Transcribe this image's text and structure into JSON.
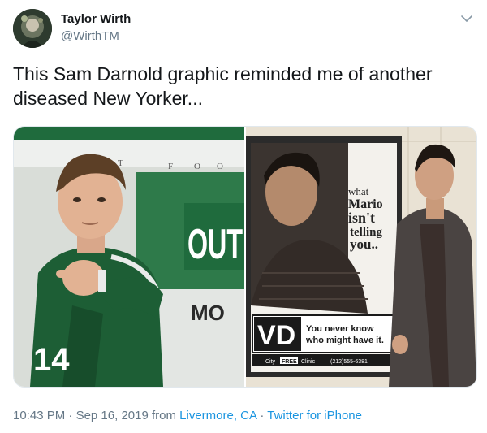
{
  "user": {
    "name": "Taylor Wirth",
    "handle": "@WirthTM"
  },
  "tweet": {
    "text_line1": "This Sam Darnold graphic reminded me of another",
    "text_line2": "diseased New Yorker..."
  },
  "media": {
    "left": {
      "banner_letters": [
        "T",
        "F",
        "O",
        "O"
      ],
      "sign_out": "OUT",
      "sign_mo": "MO"
    },
    "right": {
      "poster_words": [
        "what",
        "Mario",
        "isn't",
        "telling",
        "you.."
      ],
      "vd": "VD",
      "vd_tag_line1": "You never know",
      "vd_tag_line2": "who might have it.",
      "footer_city": "City",
      "footer_free": "FREE",
      "footer_clinic": "Clinic",
      "footer_phone": "(212)555-6381"
    }
  },
  "meta": {
    "time": "10:43 PM",
    "sep1": " · ",
    "date": "Sep 16, 2019",
    "from": " from ",
    "location": "Livermore, CA",
    "sep2": " · ",
    "source": "Twitter for iPhone"
  },
  "colors": {
    "jets_green": "#1f6b3d",
    "link_blue": "#1b95e0",
    "muted": "#657786"
  }
}
